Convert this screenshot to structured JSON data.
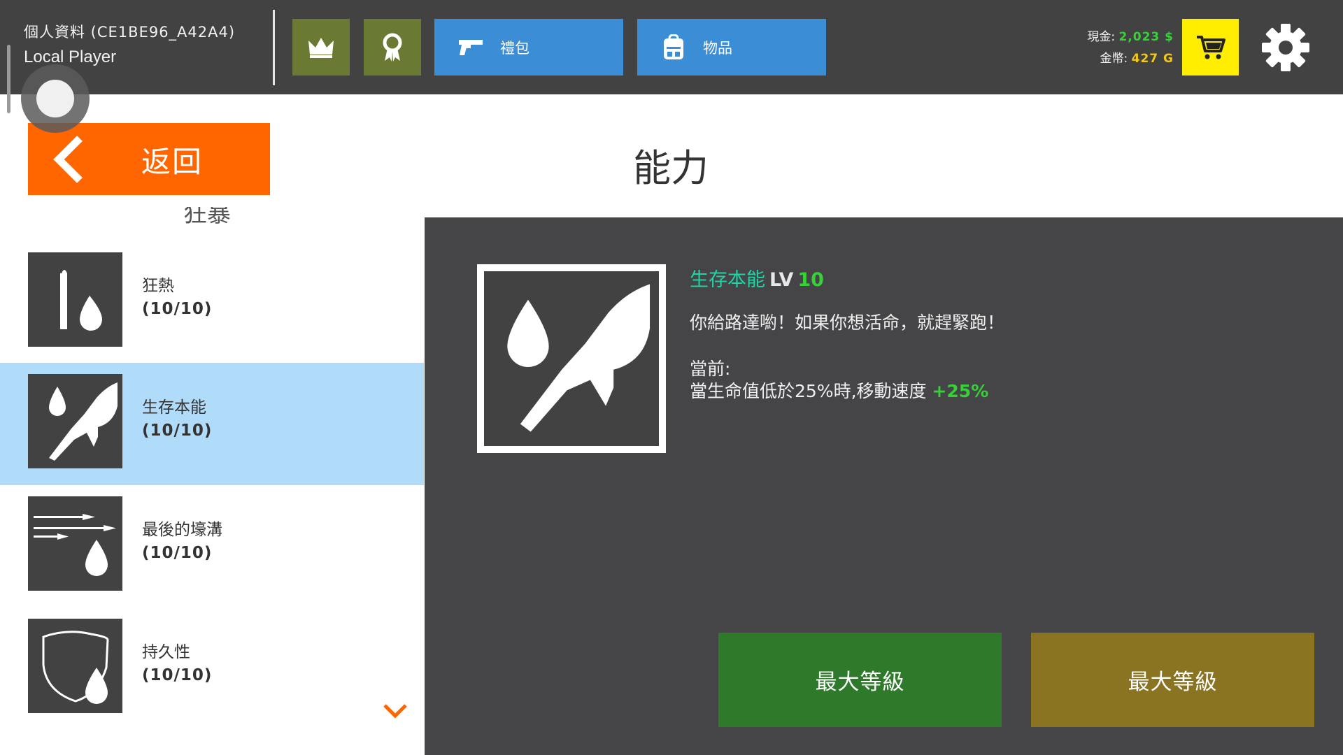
{
  "header": {
    "profile_title": "個人資料 (CE1BE96_A42A4)",
    "player_name": "Local Player",
    "crown_icon": "crown-icon",
    "ribbon_icon": "ribbon-icon",
    "gift_label": "禮包",
    "gift_icon": "pistol-icon",
    "items_label": "物品",
    "items_icon": "backpack-icon",
    "cash_label": "現金:",
    "cash_value": "2,023 $",
    "gold_label": "金幣:",
    "gold_value": "427 G",
    "cart_icon": "cart-icon",
    "settings_icon": "gear-icon",
    "colors": {
      "bar": "#424242",
      "olive": "#6b7a32",
      "blue": "#3b8dd6",
      "cart": "#ffee00",
      "cash": "#36d136",
      "gold": "#f2c814"
    }
  },
  "back_button": {
    "label": "返回",
    "icon": "chevron-left-icon",
    "color": "#ff6600"
  },
  "page_title": "能力",
  "skill_list": {
    "partial_header": "狂暴",
    "items": [
      {
        "name": "狂熱",
        "level": "(10/10)",
        "icon": "bullet-drop-icon",
        "selected": false
      },
      {
        "name": "生存本能",
        "level": "(10/10)",
        "icon": "running-drop-icon",
        "selected": true
      },
      {
        "name": "最後的壕溝",
        "level": "(10/10)",
        "icon": "bullets-drop-icon",
        "selected": false
      },
      {
        "name": "持久性",
        "level": "(10/10)",
        "icon": "shield-drop-icon",
        "selected": false
      }
    ],
    "more_icon": "chevron-down-icon"
  },
  "detail": {
    "icon": "running-drop-icon",
    "name": "生存本能",
    "lv_label": "LV",
    "lv_value": "10",
    "description": "你給路達喲！如果你想活命，就趕緊跑！",
    "current_label": "當前:",
    "current_effect": "當生命值低於25%時,移動速度",
    "current_bonus": "+25%"
  },
  "buttons": {
    "max_level_1": "最大等級",
    "max_level_2": "最大等級"
  }
}
